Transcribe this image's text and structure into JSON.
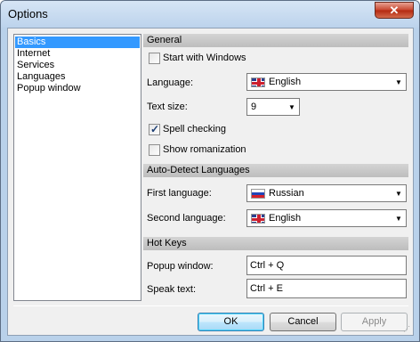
{
  "window": {
    "title": "Options",
    "close_glyph": "✕"
  },
  "nav": {
    "items": [
      {
        "label": "Basics",
        "selected": true
      },
      {
        "label": "Internet",
        "selected": false
      },
      {
        "label": "Services",
        "selected": false
      },
      {
        "label": "Languages",
        "selected": false
      },
      {
        "label": "Popup window",
        "selected": false
      }
    ]
  },
  "general": {
    "header": "General",
    "start_with_windows": {
      "label": "Start with Windows",
      "checked": false
    },
    "language": {
      "label": "Language:",
      "value": "English",
      "flag": "uk-flag-icon"
    },
    "text_size": {
      "label": "Text size:",
      "value": "9"
    },
    "spell_checking": {
      "label": "Spell checking",
      "checked": true
    },
    "show_romanization": {
      "label": "Show romanization",
      "checked": false
    }
  },
  "auto_detect": {
    "header": "Auto-Detect Languages",
    "first": {
      "label": "First language:",
      "value": "Russian",
      "flag": "ru-flag-icon"
    },
    "second": {
      "label": "Second language:",
      "value": "English",
      "flag": "uk-flag-icon"
    }
  },
  "hotkeys": {
    "header": "Hot Keys",
    "popup": {
      "label": "Popup window:",
      "value": "Ctrl + Q"
    },
    "speak": {
      "label": "Speak text:",
      "value": "Ctrl + E"
    }
  },
  "buttons": {
    "ok": "OK",
    "cancel": "Cancel",
    "apply": "Apply"
  },
  "icons": {
    "dropdown_arrow": "▼",
    "resize_grip": "⋰"
  }
}
